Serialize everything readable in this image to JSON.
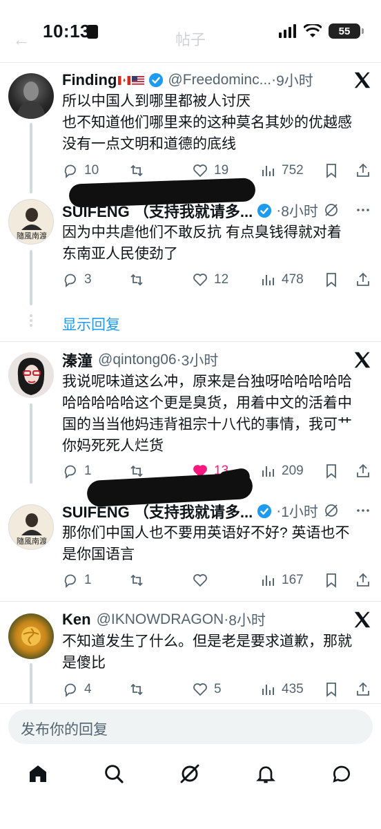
{
  "status_bar": {
    "time": "10:13",
    "battery": "55"
  },
  "nav": {
    "title": "帖子",
    "back_icon": "arrow-left-icon"
  },
  "tweets": [
    {
      "author": "Finding",
      "flags": [
        "canada-flag",
        "usa-flag"
      ],
      "handle": "@Freedominc...",
      "time": "9小时",
      "lines": [
        "所以中国人到哪里都被人讨厌",
        "也不知道他们哪里来的这种莫名其妙的优越感",
        "没有一点文明和道德的底线"
      ],
      "replies": "10",
      "reposts": "",
      "likes": "19",
      "views": "752"
    },
    {
      "author": "SUIFENG （支持我就请多...",
      "handle": "",
      "time": "8小时",
      "lines": [
        "因为中共虐他们不敢反抗 有点臭钱得就对着",
        "东南亚人民使劲了"
      ],
      "replies": "3",
      "reposts": "",
      "likes": "12",
      "views": "478"
    },
    {
      "author": "溱潼",
      "handle": "@qintong06",
      "time": "3小时",
      "lines": [
        "我说呢味道这么冲，原来是台独呀哈哈哈哈哈",
        "哈哈哈哈哈这个更是臭货，用着中文的活着中",
        "国的当当他妈违背祖宗十八代的事情，我可艹",
        "你妈死死人烂货"
      ],
      "replies": "1",
      "reposts": "",
      "likes": "13",
      "views": "209"
    },
    {
      "author": "SUIFENG （支持我就请多...",
      "handle": "",
      "time": "1小时",
      "lines": [
        "那你们中国人也不要用英语好不好? 英语也不",
        "是你国语言"
      ],
      "replies": "1",
      "reposts": "",
      "likes": "",
      "views": "167"
    },
    {
      "author": "Ken",
      "handle": "@IKNOWDRAGON",
      "time": "8小时",
      "lines": [
        "不知道发生了什么。但是老是要求道歉，那就",
        "是傻比"
      ],
      "replies": "4",
      "reposts": "",
      "likes": "5",
      "views": "435"
    }
  ],
  "show_replies": "显示回复",
  "composer": {
    "placeholder": "发布你的回复"
  },
  "tabs": [
    "home-icon",
    "search-icon",
    "grok-icon",
    "notifications-icon",
    "messages-icon"
  ],
  "colors": {
    "accent": "#1d9bf0",
    "like": "#f91880",
    "muted": "#536471"
  }
}
